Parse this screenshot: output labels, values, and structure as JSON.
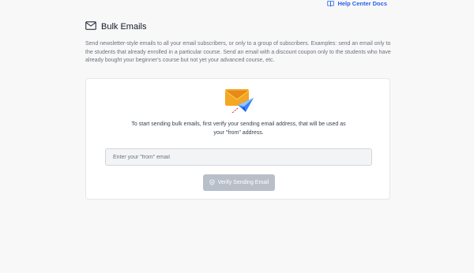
{
  "help": {
    "label": "Help Center Docs",
    "icon": "book-icon",
    "color": "#2563eb"
  },
  "header": {
    "title": "Bulk Emails",
    "icon": "mail-icon"
  },
  "description": "Send newsletter-style emails to all your email subscribers, or only to a group of subscribers. Examples: send an email only to the students that already enrolled in a particular course. Send an email with a discount coupon only to the students who have already bought your beginner's course but not yet your advanced course, etc.",
  "card": {
    "illustration": "envelope-paper-plane-illustration",
    "instructions": "To start sending bulk emails, first verify your sending email address, that will be used as your \"from\" address.",
    "input": {
      "placeholder": "Enter your \"from\" email",
      "value": ""
    },
    "verify_button": {
      "label": "Verify Sending Email",
      "icon": "shield-check-icon",
      "enabled": false
    }
  }
}
